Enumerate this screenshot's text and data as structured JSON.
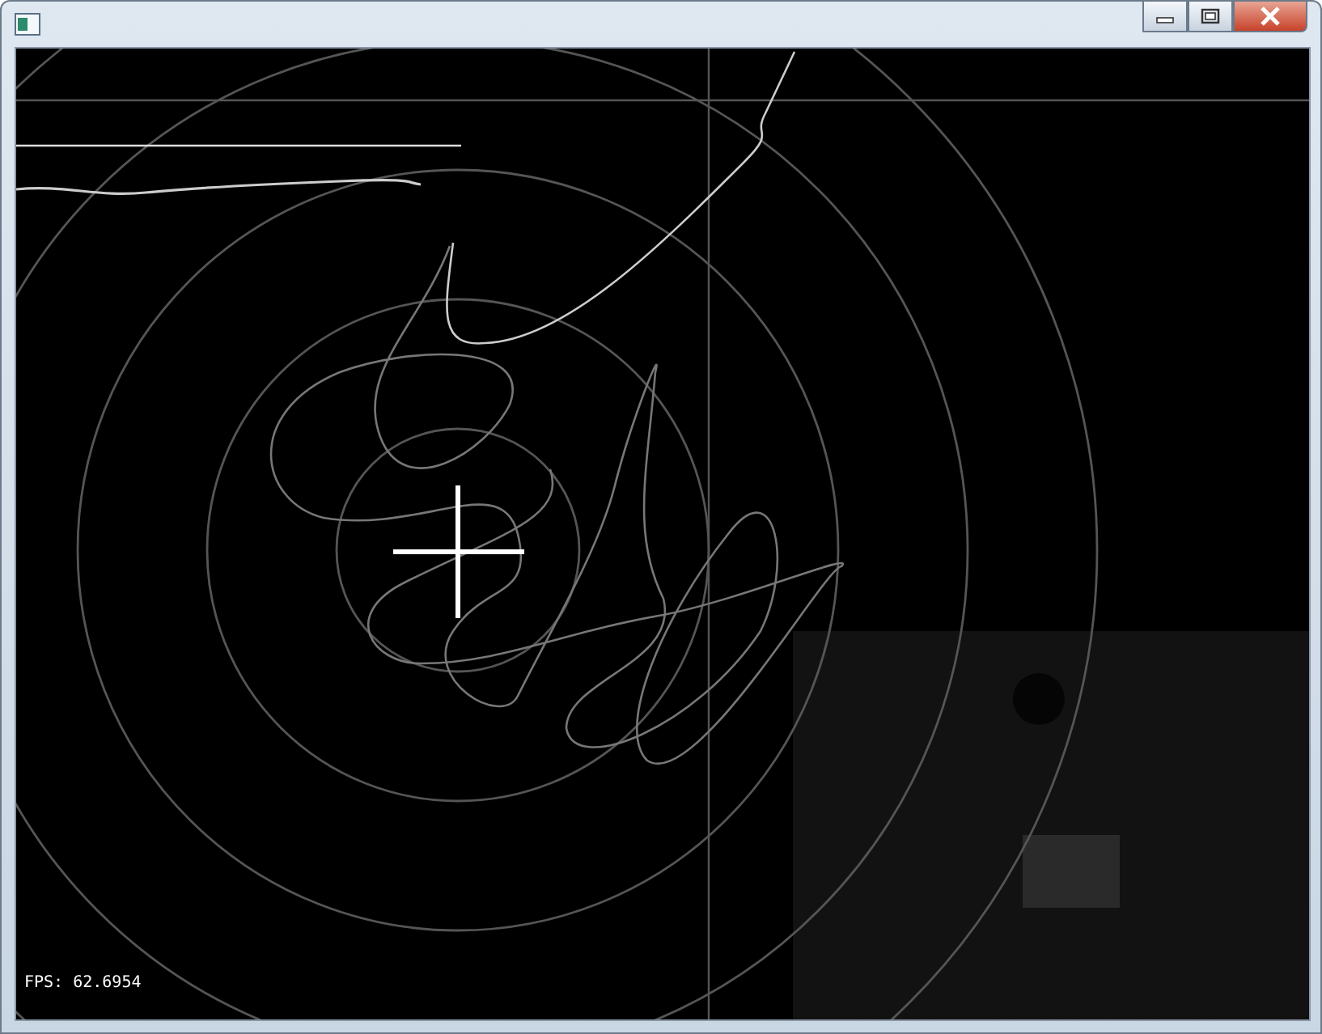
{
  "canvas": {
    "fps_readout": "FPS: 62.6954"
  }
}
